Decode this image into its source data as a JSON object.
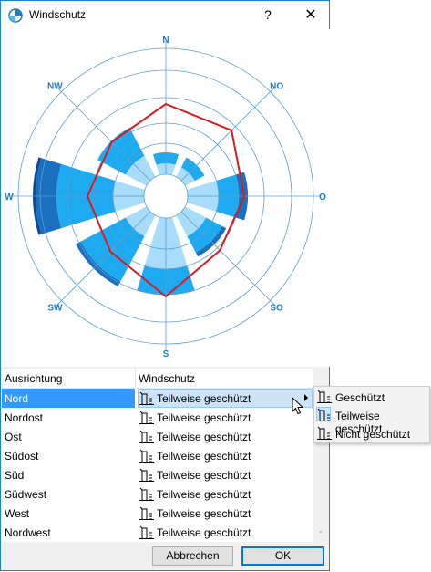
{
  "window": {
    "title": "Windschutz",
    "help_label": "?",
    "close_label": "✕"
  },
  "rose": {
    "directions": [
      "N",
      "NO",
      "O",
      "SO",
      "S",
      "SW",
      "W",
      "NW"
    ],
    "label_color": "#1d7cc2",
    "line_color": "#5a9fd4",
    "polygon_color": "#d71920",
    "segment_colors": [
      "#a8dcf8",
      "#1eaaf1",
      "#1a6fbe",
      "#0a4a90"
    ]
  },
  "table": {
    "col1_header": "Ausrichtung",
    "col2_header": "Windschutz",
    "rows": [
      {
        "direction": "Nord",
        "value": "Teilweise geschützt",
        "selected": true
      },
      {
        "direction": "Nordost",
        "value": "Teilweise geschützt"
      },
      {
        "direction": "Ost",
        "value": "Teilweise geschützt"
      },
      {
        "direction": "Südost",
        "value": "Teilweise geschützt"
      },
      {
        "direction": "Süd",
        "value": "Teilweise geschützt"
      },
      {
        "direction": "Südwest",
        "value": "Teilweise geschützt"
      },
      {
        "direction": "West",
        "value": "Teilweise geschützt"
      },
      {
        "direction": "Nordwest",
        "value": "Teilweise geschützt"
      }
    ]
  },
  "buttons": {
    "cancel": "Abbrechen",
    "ok": "OK"
  },
  "menu": {
    "items": [
      {
        "label": "Geschützt",
        "icon": "protected-icon"
      },
      {
        "label": "Teilweise geschützt",
        "icon": "partially-protected-icon",
        "checked": true
      },
      {
        "label": "Nicht geschützt",
        "icon": "unprotected-icon"
      }
    ]
  }
}
